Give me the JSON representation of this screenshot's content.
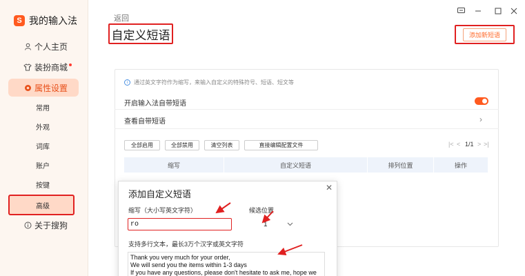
{
  "app": {
    "name": "我的输入法",
    "logo_glyph": "S"
  },
  "sidebar": {
    "items": [
      {
        "label": "个人主页",
        "icon": "user-icon"
      },
      {
        "label": "装扮商城",
        "icon": "shirt-icon"
      },
      {
        "label": "属性设置",
        "icon": "settings-icon"
      }
    ],
    "sub_items": [
      "常用",
      "外观",
      "词库",
      "账户",
      "按键",
      "高级"
    ],
    "about": "关于搜狗"
  },
  "header": {
    "back": "返回",
    "title": "自定义短语",
    "add_button": "添加新短语"
  },
  "panel": {
    "tip": "通过英文字符作为缩写，来输入自定义的特殊符号、短语、短文等",
    "row_enable": "开启输入法自带短语",
    "row_view": "查看自带短语",
    "buttons": [
      "全部启用",
      "全部禁用",
      "清空列表",
      "直接编辑配置文件"
    ],
    "pager": {
      "first": "|<",
      "prev": "<",
      "page": "1/1",
      "next": ">",
      "last": ">|"
    },
    "table_headers": [
      "缩写",
      "自定义短语",
      "排列位置",
      "操作"
    ]
  },
  "dialog": {
    "title": "添加自定义短语",
    "close": "✕",
    "abbr_label": "缩写（大小写英文字符）",
    "abbr_value": "ro",
    "pos_label": "候选位置",
    "pos_value": "1",
    "text_label": "支持多行文本，最长3万个汉字或英文字符",
    "text_lines": [
      "Thank you very much for your order,",
      "We will send you the items within 1-3 days",
      "If you have any questions, please don't hesitate to ask me, hope we"
    ]
  },
  "colors": {
    "accent": "#ff5a1f",
    "annotation": "#e02020"
  }
}
